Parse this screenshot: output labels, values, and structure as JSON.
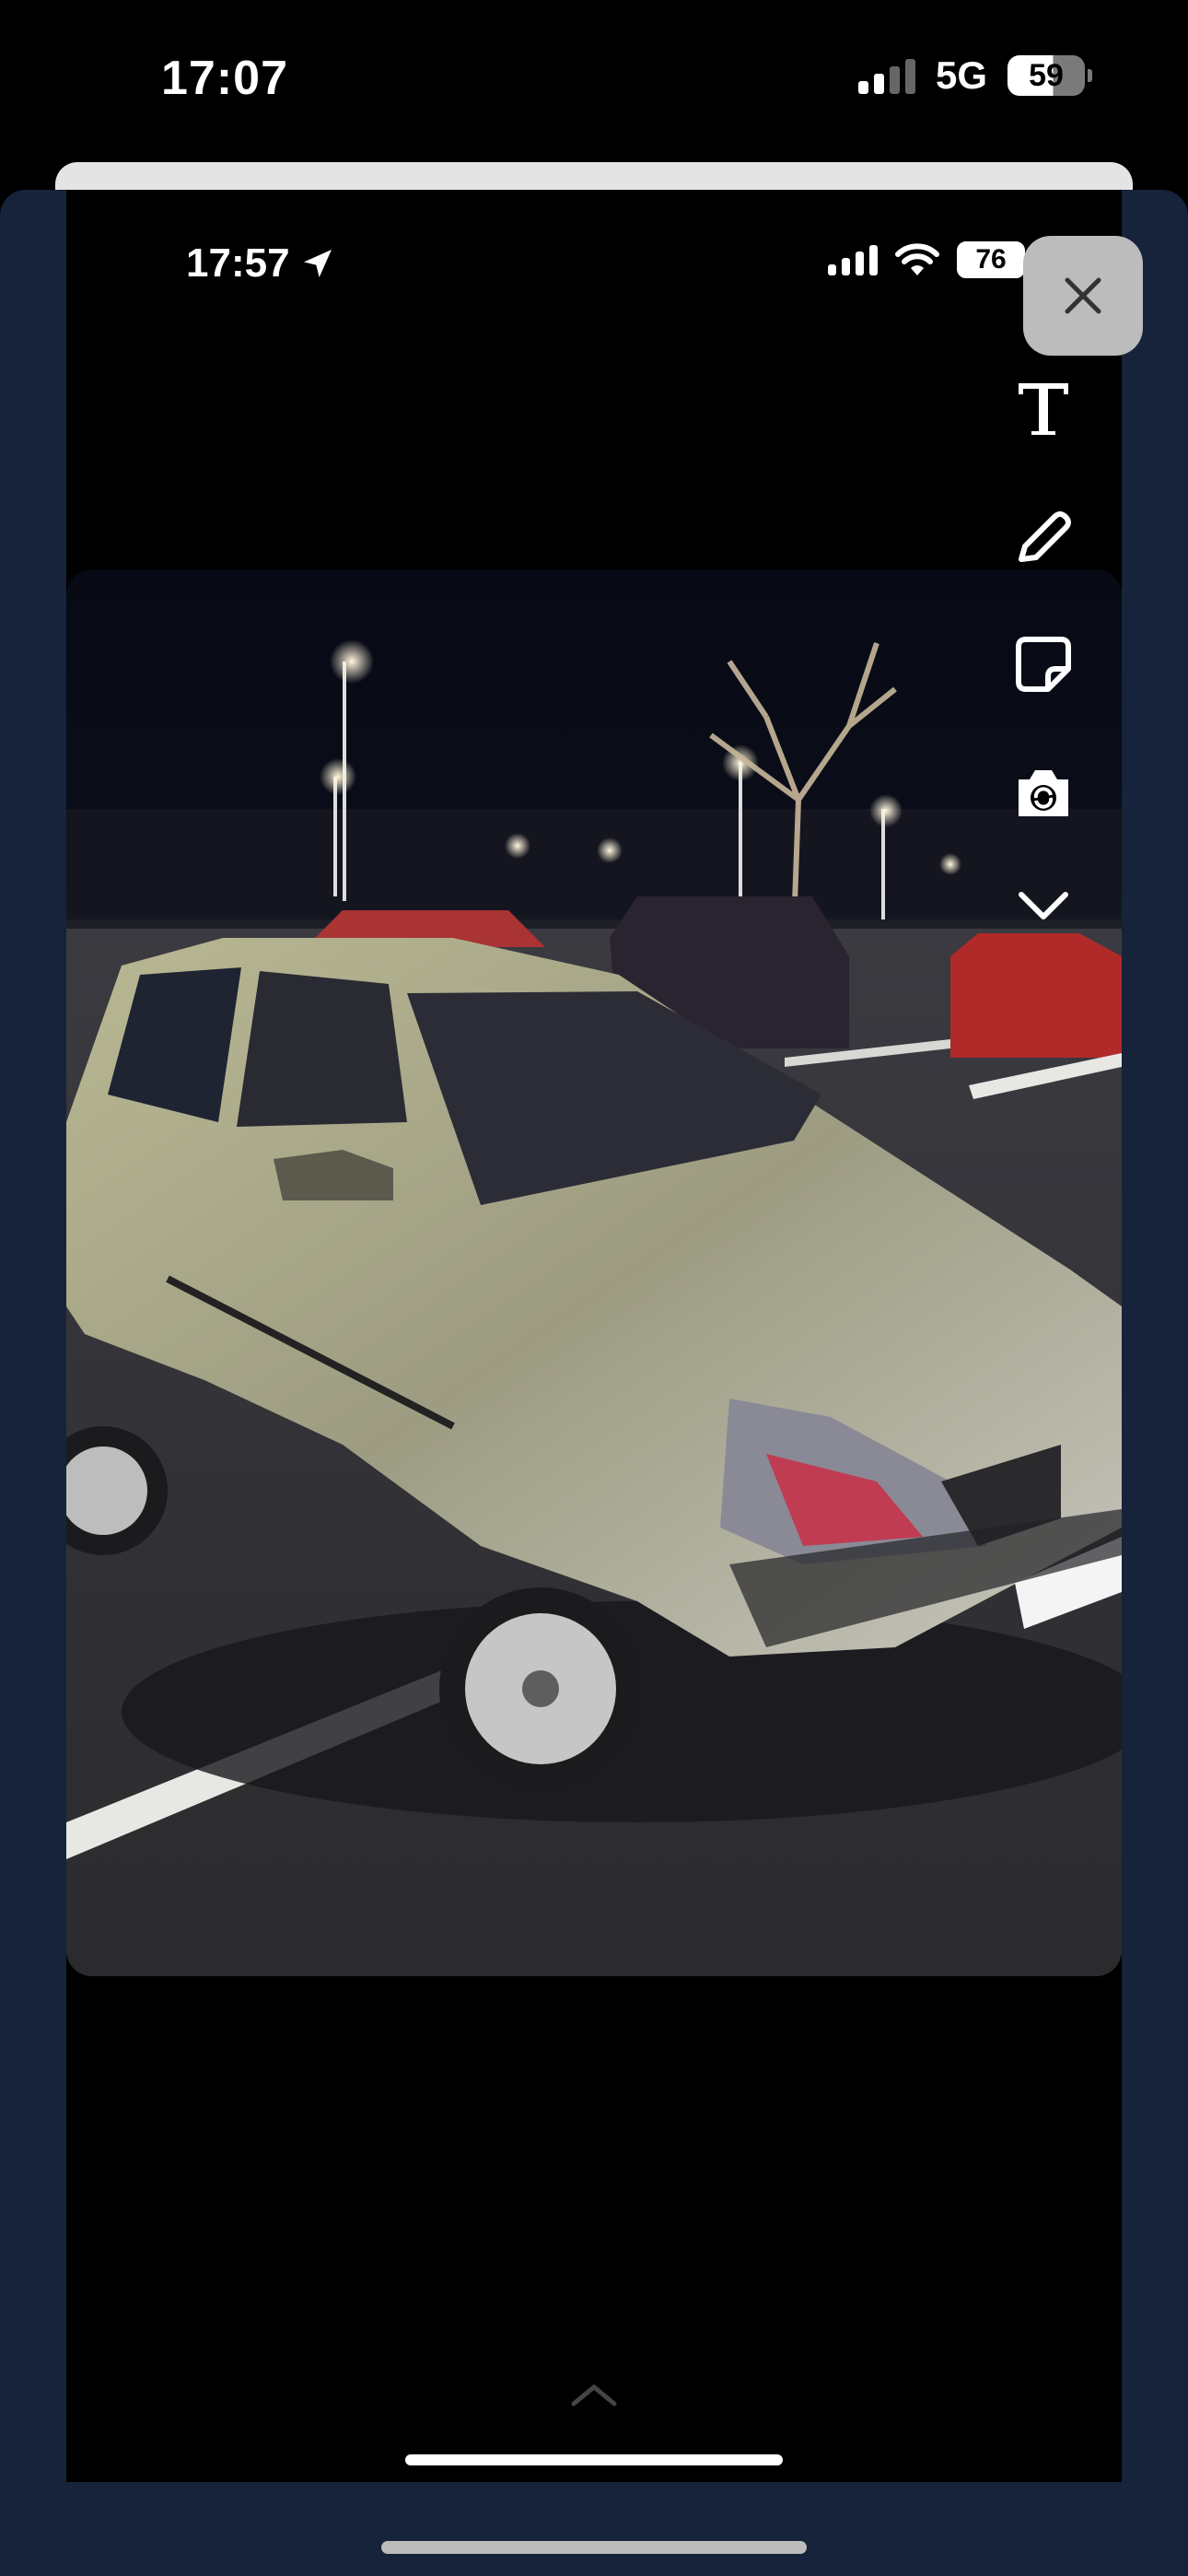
{
  "outer_status_bar": {
    "time": "17:07",
    "network": "5G",
    "battery": "59",
    "icons": [
      "signal-icon",
      "battery-icon"
    ]
  },
  "inner_status_bar": {
    "time": "17:57",
    "battery": "76",
    "icons": [
      "location-arrow-icon",
      "signal-icon",
      "wifi-icon",
      "battery-icon"
    ]
  },
  "editor": {
    "close_icon": "close-icon",
    "tools": [
      "text-icon",
      "pencil-icon",
      "sticker-icon",
      "camera-swap-icon",
      "chevron-down-icon"
    ]
  },
  "photo": {
    "subject": "silver hatchback car in parking lot at night"
  },
  "colors": {
    "sheet_background": "#16233a",
    "close_button": "#bcbcbc",
    "car_body": "#a8a78c"
  }
}
